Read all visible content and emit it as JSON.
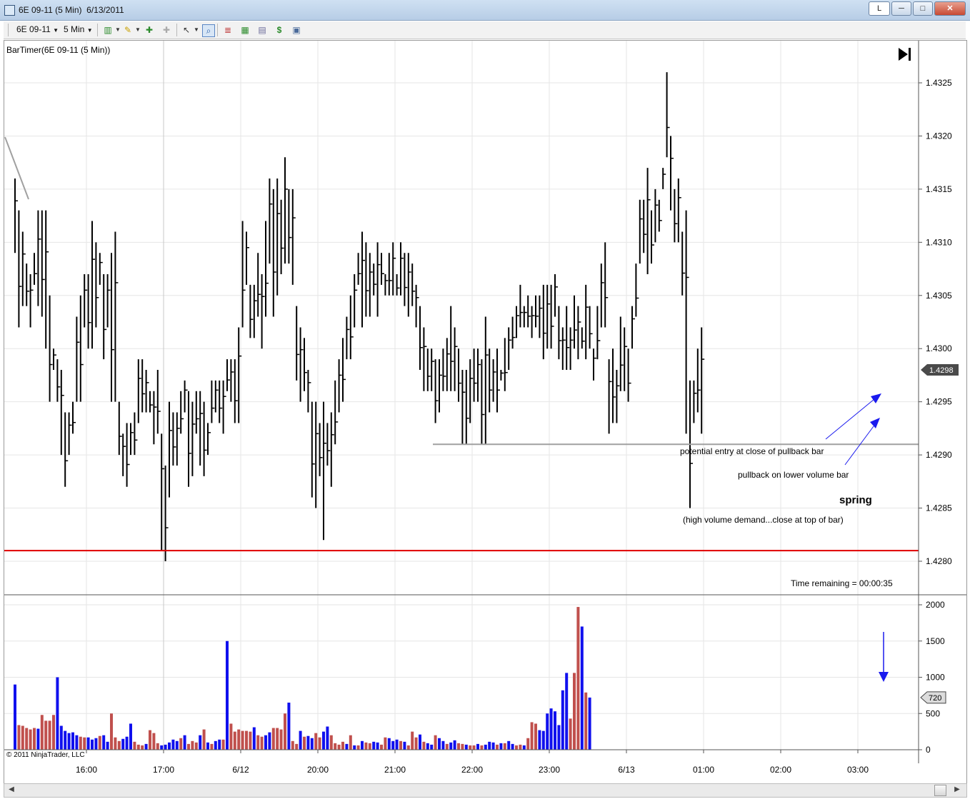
{
  "window": {
    "title": "6E 09-11 (5 Min)  6/13/2011",
    "btn_l": "L",
    "btn_min": "─",
    "btn_max": "□",
    "btn_close": "✕"
  },
  "toolbar": {
    "instrument": "6E 09-11",
    "interval": "5 Min",
    "icons": [
      "bar-style-icon",
      "draw-pencil-icon",
      "tool-icon",
      "tool-disabled-icon",
      "cursor-icon",
      "zoom-icon",
      "indicators-icon",
      "strategies-icon",
      "properties-icon",
      "dollar-icon",
      "data-box-icon"
    ]
  },
  "chart": {
    "indicator_label": "BarTimer(6E 09-11 (5 Min))",
    "time_remaining": "Time remaining = 00:00:35",
    "copyright": "© 2011 NinjaTrader, LLC",
    "annotations": {
      "entry": "potential entry at close of pullback bar",
      "pullback": "pullback on lower volume bar",
      "spring": "spring",
      "demand": "(high volume demand...close at top of bar)"
    },
    "current_price": "1.4298",
    "current_volume": "720",
    "colors": {
      "up_volume": "#1010ee",
      "down_volume": "#c0504d",
      "support": "#e00000",
      "level": "#a0a0a0",
      "arrow": "#1a1aee"
    }
  },
  "chart_data": {
    "type": "bar",
    "price_axis": {
      "ticks": [
        "1.4325",
        "1.4320",
        "1.4315",
        "1.4310",
        "1.4305",
        "1.4300",
        "1.4295",
        "1.4290",
        "1.4285",
        "1.4280"
      ],
      "range": [
        1.42775,
        1.43295
      ]
    },
    "volume_axis": {
      "ticks": [
        "2000",
        "1500",
        "1000",
        "500",
        "0"
      ],
      "range": [
        0,
        2040
      ]
    },
    "time_axis": {
      "ticks": [
        "16:00",
        "17:00",
        "6/12",
        "20:00",
        "21:00",
        "22:00",
        "23:00",
        "6/13",
        "01:00",
        "02:00",
        "03:00"
      ]
    },
    "support_level": 1.4281,
    "entry_level": 1.4291,
    "current_price": 1.4298,
    "bars": [
      [
        1.4316,
        1.4309
      ],
      [
        1.4313,
        1.4302
      ],
      [
        1.4311,
        1.4304
      ],
      [
        1.4308,
        1.4304
      ],
      [
        1.4307,
        1.4302
      ],
      [
        1.4309,
        1.4306
      ],
      [
        1.4313,
        1.4304
      ],
      [
        1.4313,
        1.4303
      ],
      [
        1.4313,
        1.43
      ],
      [
        1.4305,
        1.4295
      ],
      [
        1.43,
        1.4298
      ],
      [
        1.4299,
        1.4295
      ],
      [
        1.4298,
        1.429
      ],
      [
        1.4294,
        1.4287
      ],
      [
        1.4294,
        1.429
      ],
      [
        1.4295,
        1.4292
      ],
      [
        1.4303,
        1.4295
      ],
      [
        1.4305,
        1.4295
      ],
      [
        1.4307,
        1.4302
      ],
      [
        1.4307,
        1.43
      ],
      [
        1.4312,
        1.43
      ],
      [
        1.431,
        1.4302
      ],
      [
        1.4309,
        1.4306
      ],
      [
        1.4307,
        1.4299
      ],
      [
        1.4307,
        1.4302
      ],
      [
        1.4309,
        1.4295
      ],
      [
        1.4311,
        1.4295
      ],
      [
        1.4295,
        1.429
      ],
      [
        1.4292,
        1.4288
      ],
      [
        1.4293,
        1.4287
      ],
      [
        1.4293,
        1.429
      ],
      [
        1.4294,
        1.429
      ],
      [
        1.4299,
        1.4293
      ],
      [
        1.4299,
        1.4294
      ],
      [
        1.4298,
        1.4294
      ],
      [
        1.4296,
        1.4294
      ],
      [
        1.4296,
        1.4291
      ],
      [
        1.4298,
        1.4292
      ],
      [
        1.4292,
        1.4281
      ],
      [
        1.4289,
        1.428
      ],
      [
        1.4295,
        1.4286
      ],
      [
        1.4294,
        1.4289
      ],
      [
        1.4294,
        1.4289
      ],
      [
        1.4296,
        1.4292
      ],
      [
        1.4297,
        1.4294
      ],
      [
        1.4296,
        1.4287
      ],
      [
        1.4295,
        1.4288
      ],
      [
        1.4296,
        1.4292
      ],
      [
        1.4296,
        1.4289
      ],
      [
        1.4295,
        1.4288
      ],
      [
        1.4293,
        1.429
      ],
      [
        1.4297,
        1.4293
      ],
      [
        1.4297,
        1.4294
      ],
      [
        1.4297,
        1.4293
      ],
      [
        1.4297,
        1.4292
      ],
      [
        1.4299,
        1.4296
      ],
      [
        1.4299,
        1.4295
      ],
      [
        1.4299,
        1.4293
      ],
      [
        1.4302,
        1.4293
      ],
      [
        1.4312,
        1.4302
      ],
      [
        1.4311,
        1.4306
      ],
      [
        1.4306,
        1.4301
      ],
      [
        1.4306,
        1.4301
      ],
      [
        1.4309,
        1.4303
      ],
      [
        1.4307,
        1.43
      ],
      [
        1.4312,
        1.4303
      ],
      [
        1.4316,
        1.4308
      ],
      [
        1.4315,
        1.4303
      ],
      [
        1.4316,
        1.4305
      ],
      [
        1.4314,
        1.4307
      ],
      [
        1.4318,
        1.4308
      ],
      [
        1.4315,
        1.4308
      ],
      [
        1.4315,
        1.4306
      ],
      [
        1.4304,
        1.4297
      ],
      [
        1.4302,
        1.4295
      ],
      [
        1.4301,
        1.4296
      ],
      [
        1.4298,
        1.4294
      ],
      [
        1.4295,
        1.4286
      ],
      [
        1.4295,
        1.4285
      ],
      [
        1.4293,
        1.4288
      ],
      [
        1.4295,
        1.4282
      ],
      [
        1.4293,
        1.4289
      ],
      [
        1.4294,
        1.4287
      ],
      [
        1.4297,
        1.4291
      ],
      [
        1.4299,
        1.4294
      ],
      [
        1.4301,
        1.4295
      ],
      [
        1.4303,
        1.4299
      ],
      [
        1.4305,
        1.4299
      ],
      [
        1.4307,
        1.4302
      ],
      [
        1.4309,
        1.4306
      ],
      [
        1.4311,
        1.4302
      ],
      [
        1.431,
        1.4303
      ],
      [
        1.4309,
        1.4303
      ],
      [
        1.4308,
        1.4305
      ],
      [
        1.431,
        1.4303
      ],
      [
        1.4309,
        1.4306
      ],
      [
        1.4307,
        1.4305
      ],
      [
        1.4309,
        1.4305
      ],
      [
        1.431,
        1.4305
      ],
      [
        1.4307,
        1.4305
      ],
      [
        1.431,
        1.4305
      ],
      [
        1.4309,
        1.4304
      ],
      [
        1.4309,
        1.4303
      ],
      [
        1.4308,
        1.4304
      ],
      [
        1.4306,
        1.4302
      ],
      [
        1.4304,
        1.4298
      ],
      [
        1.4302,
        1.4296
      ],
      [
        1.43,
        1.4296
      ],
      [
        1.43,
        1.4296
      ],
      [
        1.4299,
        1.4293
      ],
      [
        1.4299,
        1.4294
      ],
      [
        1.43,
        1.4296
      ],
      [
        1.4301,
        1.4296
      ],
      [
        1.4304,
        1.4296
      ],
      [
        1.4302,
        1.4296
      ],
      [
        1.43,
        1.4295
      ],
      [
        1.4298,
        1.4291
      ],
      [
        1.4298,
        1.4291
      ],
      [
        1.4299,
        1.4293
      ],
      [
        1.43,
        1.4295
      ],
      [
        1.43,
        1.4295
      ],
      [
        1.4299,
        1.4291
      ],
      [
        1.4303,
        1.4291
      ],
      [
        1.43,
        1.4294
      ],
      [
        1.4299,
        1.4295
      ],
      [
        1.43,
        1.4294
      ],
      [
        1.4298,
        1.4297
      ],
      [
        1.4301,
        1.4296
      ],
      [
        1.4302,
        1.4298
      ],
      [
        1.4303,
        1.43
      ],
      [
        1.4304,
        1.4301
      ],
      [
        1.4306,
        1.4302
      ],
      [
        1.4304,
        1.4302
      ],
      [
        1.4305,
        1.4302
      ],
      [
        1.4304,
        1.4301
      ],
      [
        1.4305,
        1.4302
      ],
      [
        1.4305,
        1.4301
      ],
      [
        1.4306,
        1.4299
      ],
      [
        1.4306,
        1.43
      ],
      [
        1.4306,
        1.43
      ],
      [
        1.4307,
        1.4303
      ],
      [
        1.4304,
        1.4299
      ],
      [
        1.4302,
        1.4298
      ],
      [
        1.4304,
        1.4298
      ],
      [
        1.4302,
        1.4298
      ],
      [
        1.4305,
        1.43
      ],
      [
        1.4304,
        1.4299
      ],
      [
        1.4302,
        1.43
      ],
      [
        1.4306,
        1.4299
      ],
      [
        1.4304,
        1.43
      ],
      [
        1.43,
        1.4297
      ],
      [
        1.4304,
        1.4299
      ],
      [
        1.4308,
        1.4302
      ],
      [
        1.431,
        1.4302
      ],
      [
        1.4299,
        1.4292
      ],
      [
        1.43,
        1.4293
      ],
      [
        1.4298,
        1.4293
      ],
      [
        1.4303,
        1.4296
      ],
      [
        1.4302,
        1.4296
      ],
      [
        1.43,
        1.4295
      ],
      [
        1.4304,
        1.43
      ],
      [
        1.4308,
        1.4303
      ],
      [
        1.4314,
        1.4308
      ],
      [
        1.4314,
        1.4309
      ],
      [
        1.4317,
        1.4307
      ],
      [
        1.4313,
        1.4308
      ],
      [
        1.4315,
        1.431
      ],
      [
        1.4314,
        1.4311
      ],
      [
        1.4317,
        1.4315
      ],
      [
        1.4326,
        1.4318
      ],
      [
        1.432,
        1.4313
      ],
      [
        1.4315,
        1.431
      ],
      [
        1.4316,
        1.431
      ],
      [
        1.4311,
        1.4305
      ],
      [
        1.4313,
        1.4292
      ],
      [
        1.4297,
        1.4285
      ],
      [
        1.4297,
        1.4293
      ],
      [
        1.43,
        1.4294
      ],
      [
        1.4302,
        1.4292
      ]
    ],
    "volume": [
      [
        "u",
        900
      ],
      [
        "d",
        340
      ],
      [
        "d",
        330
      ],
      [
        "d",
        300
      ],
      [
        "d",
        280
      ],
      [
        "d",
        300
      ],
      [
        "u",
        290
      ],
      [
        "d",
        480
      ],
      [
        "d",
        400
      ],
      [
        "d",
        400
      ],
      [
        "d",
        480
      ],
      [
        "u",
        1000
      ],
      [
        "u",
        330
      ],
      [
        "u",
        260
      ],
      [
        "u",
        230
      ],
      [
        "u",
        240
      ],
      [
        "u",
        200
      ],
      [
        "d",
        180
      ],
      [
        "d",
        170
      ],
      [
        "u",
        170
      ],
      [
        "u",
        140
      ],
      [
        "u",
        160
      ],
      [
        "d",
        190
      ],
      [
        "u",
        200
      ],
      [
        "u",
        110
      ],
      [
        "d",
        500
      ],
      [
        "d",
        170
      ],
      [
        "d",
        120
      ],
      [
        "u",
        150
      ],
      [
        "u",
        180
      ],
      [
        "u",
        360
      ],
      [
        "d",
        110
      ],
      [
        "d",
        70
      ],
      [
        "d",
        60
      ],
      [
        "u",
        80
      ],
      [
        "d",
        270
      ],
      [
        "d",
        230
      ],
      [
        "d",
        90
      ],
      [
        "u",
        60
      ],
      [
        "u",
        70
      ],
      [
        "u",
        100
      ],
      [
        "u",
        140
      ],
      [
        "u",
        120
      ],
      [
        "d",
        160
      ],
      [
        "u",
        200
      ],
      [
        "d",
        80
      ],
      [
        "d",
        120
      ],
      [
        "d",
        100
      ],
      [
        "u",
        200
      ],
      [
        "d",
        280
      ],
      [
        "u",
        100
      ],
      [
        "d",
        80
      ],
      [
        "u",
        120
      ],
      [
        "u",
        140
      ],
      [
        "d",
        140
      ],
      [
        "u",
        1500
      ],
      [
        "d",
        360
      ],
      [
        "d",
        250
      ],
      [
        "d",
        280
      ],
      [
        "d",
        260
      ],
      [
        "d",
        260
      ],
      [
        "d",
        250
      ],
      [
        "u",
        310
      ],
      [
        "d",
        200
      ],
      [
        "d",
        180
      ],
      [
        "u",
        200
      ],
      [
        "u",
        240
      ],
      [
        "d",
        300
      ],
      [
        "d",
        300
      ],
      [
        "d",
        280
      ],
      [
        "d",
        500
      ],
      [
        "u",
        650
      ],
      [
        "d",
        120
      ],
      [
        "d",
        80
      ],
      [
        "u",
        260
      ],
      [
        "d",
        180
      ],
      [
        "u",
        190
      ],
      [
        "u",
        160
      ],
      [
        "d",
        230
      ],
      [
        "d",
        170
      ],
      [
        "u",
        250
      ],
      [
        "u",
        320
      ],
      [
        "d",
        200
      ],
      [
        "d",
        90
      ],
      [
        "d",
        70
      ],
      [
        "d",
        110
      ],
      [
        "u",
        80
      ],
      [
        "d",
        200
      ],
      [
        "u",
        60
      ],
      [
        "d",
        60
      ],
      [
        "u",
        120
      ],
      [
        "d",
        100
      ],
      [
        "d",
        90
      ],
      [
        "u",
        110
      ],
      [
        "u",
        100
      ],
      [
        "d",
        70
      ],
      [
        "d",
        170
      ],
      [
        "u",
        160
      ],
      [
        "u",
        120
      ],
      [
        "u",
        140
      ],
      [
        "d",
        120
      ],
      [
        "u",
        110
      ],
      [
        "d",
        60
      ],
      [
        "d",
        250
      ],
      [
        "d",
        170
      ],
      [
        "u",
        210
      ],
      [
        "d",
        110
      ],
      [
        "u",
        90
      ],
      [
        "u",
        70
      ],
      [
        "d",
        200
      ],
      [
        "u",
        160
      ],
      [
        "u",
        120
      ],
      [
        "d",
        80
      ],
      [
        "u",
        100
      ],
      [
        "u",
        130
      ],
      [
        "d",
        90
      ],
      [
        "d",
        80
      ],
      [
        "u",
        70
      ],
      [
        "d",
        60
      ],
      [
        "d",
        60
      ],
      [
        "u",
        80
      ],
      [
        "d",
        60
      ],
      [
        "u",
        70
      ],
      [
        "u",
        110
      ],
      [
        "u",
        100
      ],
      [
        "d",
        70
      ],
      [
        "u",
        90
      ],
      [
        "d",
        90
      ],
      [
        "u",
        120
      ],
      [
        "u",
        80
      ],
      [
        "d",
        60
      ],
      [
        "d",
        70
      ],
      [
        "u",
        60
      ],
      [
        "d",
        160
      ],
      [
        "d",
        380
      ],
      [
        "d",
        360
      ],
      [
        "u",
        270
      ],
      [
        "u",
        260
      ],
      [
        "u",
        500
      ],
      [
        "u",
        570
      ],
      [
        "u",
        530
      ],
      [
        "u",
        340
      ],
      [
        "u",
        820
      ],
      [
        "u",
        1060
      ],
      [
        "d",
        430
      ],
      [
        "d",
        1060
      ],
      [
        "d",
        1970
      ],
      [
        "u",
        1700
      ],
      [
        "d",
        790
      ],
      [
        "u",
        720
      ]
    ]
  }
}
